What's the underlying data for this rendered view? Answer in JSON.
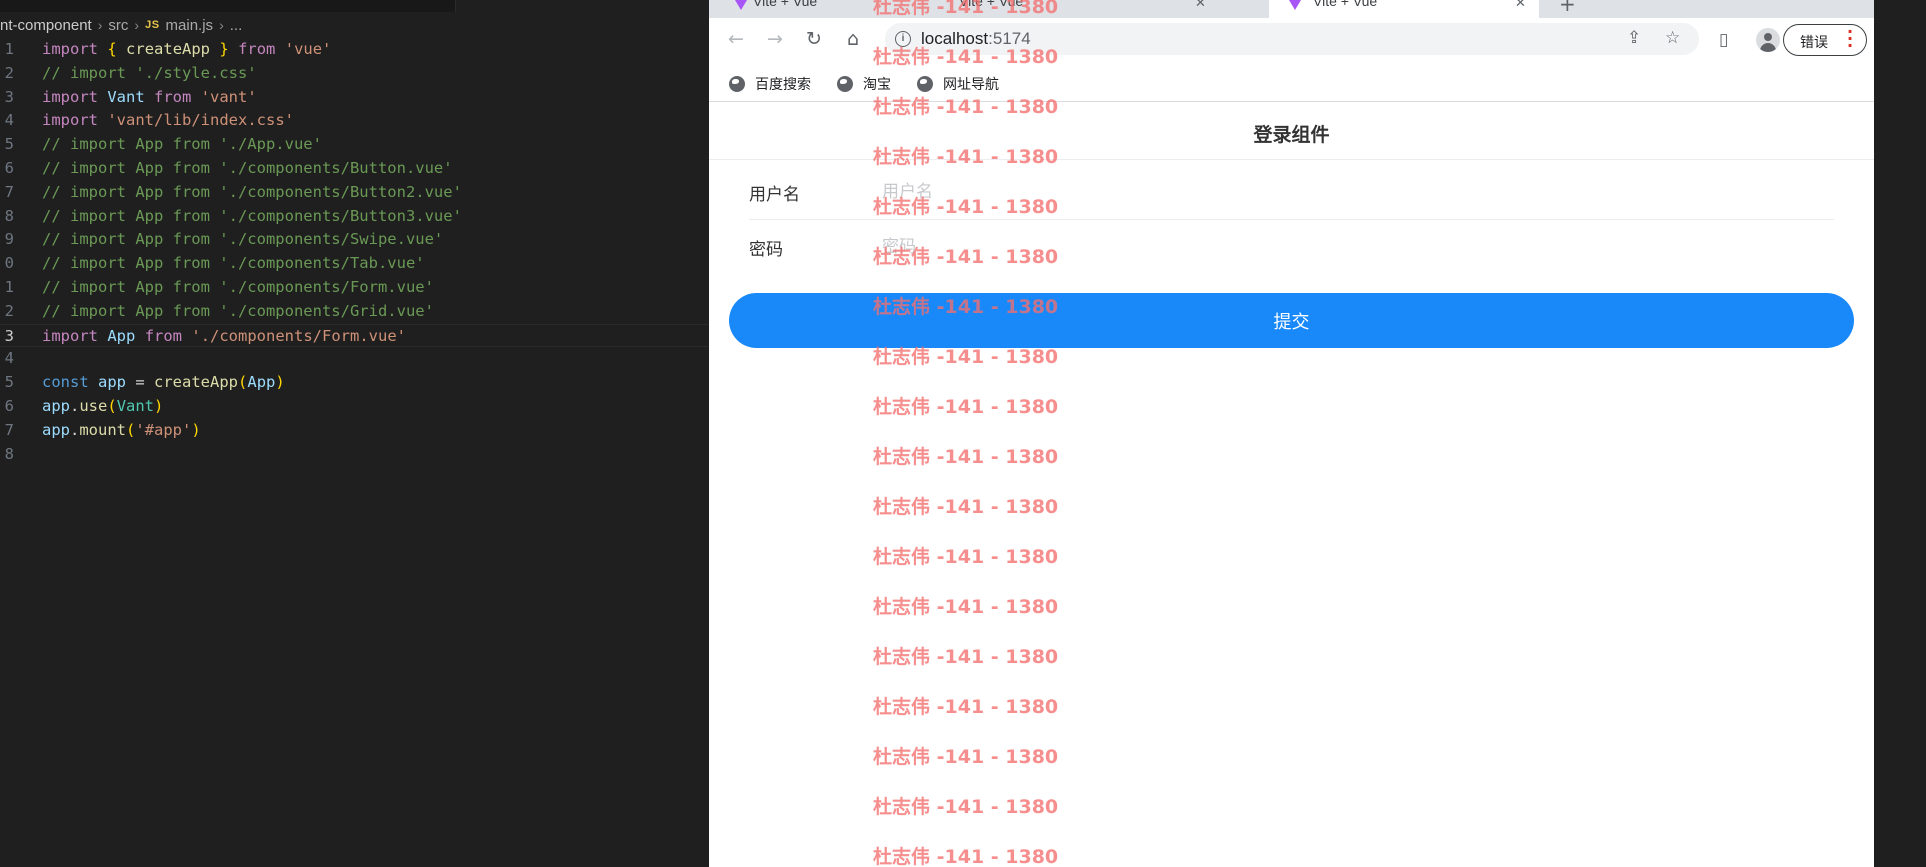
{
  "editor": {
    "breadcrumb": {
      "project": "nt-component",
      "folder": "src",
      "file_icon": "JS",
      "file": "main.js",
      "more": "..."
    },
    "active_line": 13,
    "lines": [
      {
        "n": "1",
        "tokens": [
          [
            "kw",
            "import"
          ],
          [
            "pl",
            " "
          ],
          [
            "br",
            "{"
          ],
          [
            "pl",
            " "
          ],
          [
            "fn",
            "createApp"
          ],
          [
            "pl",
            " "
          ],
          [
            "br",
            "}"
          ],
          [
            "pl",
            " "
          ],
          [
            "kw",
            "from"
          ],
          [
            "pl",
            " "
          ],
          [
            "str",
            "'vue'"
          ]
        ]
      },
      {
        "n": "2",
        "tokens": [
          [
            "cm",
            "// import './style.css'"
          ]
        ]
      },
      {
        "n": "3",
        "tokens": [
          [
            "kw",
            "import"
          ],
          [
            "pl",
            " "
          ],
          [
            "id",
            "Vant"
          ],
          [
            "pl",
            " "
          ],
          [
            "kw",
            "from"
          ],
          [
            "pl",
            " "
          ],
          [
            "str",
            "'vant'"
          ]
        ]
      },
      {
        "n": "4",
        "tokens": [
          [
            "kw",
            "import"
          ],
          [
            "pl",
            " "
          ],
          [
            "str",
            "'vant/lib/index.css'"
          ]
        ]
      },
      {
        "n": "5",
        "tokens": [
          [
            "cm",
            "// import App from './App.vue'"
          ]
        ]
      },
      {
        "n": "6",
        "tokens": [
          [
            "cm",
            "// import App from './components/Button.vue'"
          ]
        ]
      },
      {
        "n": "7",
        "tokens": [
          [
            "cm",
            "// import App from './components/Button2.vue'"
          ]
        ]
      },
      {
        "n": "8",
        "tokens": [
          [
            "cm",
            "// import App from './components/Button3.vue'"
          ]
        ]
      },
      {
        "n": "9",
        "tokens": [
          [
            "cm",
            "// import App from './components/Swipe.vue'"
          ]
        ]
      },
      {
        "n": "0",
        "tokens": [
          [
            "cm",
            "// import App from './components/Tab.vue'"
          ]
        ]
      },
      {
        "n": "1",
        "tokens": [
          [
            "cm",
            "// import App from './components/Form.vue'"
          ]
        ]
      },
      {
        "n": "2",
        "tokens": [
          [
            "cm",
            "// import App from './components/Grid.vue'"
          ]
        ]
      },
      {
        "n": "3",
        "tokens": [
          [
            "kw",
            "import"
          ],
          [
            "pl",
            " "
          ],
          [
            "id",
            "App"
          ],
          [
            "pl",
            " "
          ],
          [
            "kw",
            "from"
          ],
          [
            "pl",
            " "
          ],
          [
            "str",
            "'./components/Form.vue'"
          ]
        ]
      },
      {
        "n": "4",
        "tokens": []
      },
      {
        "n": "5",
        "tokens": [
          [
            "const",
            "const"
          ],
          [
            "pl",
            " "
          ],
          [
            "id",
            "app"
          ],
          [
            "pl",
            " = "
          ],
          [
            "fn",
            "createApp"
          ],
          [
            "br",
            "("
          ],
          [
            "id",
            "App"
          ],
          [
            "br",
            ")"
          ]
        ]
      },
      {
        "n": "6",
        "tokens": [
          [
            "id",
            "app"
          ],
          [
            "pl",
            "."
          ],
          [
            "fn",
            "use"
          ],
          [
            "br",
            "("
          ],
          [
            "cls",
            "Vant"
          ],
          [
            "br",
            ")"
          ]
        ]
      },
      {
        "n": "7",
        "tokens": [
          [
            "id",
            "app"
          ],
          [
            "pl",
            "."
          ],
          [
            "fn",
            "mount"
          ],
          [
            "br",
            "("
          ],
          [
            "str",
            "'#app'"
          ],
          [
            "br",
            ")"
          ]
        ]
      },
      {
        "n": "8",
        "tokens": []
      }
    ]
  },
  "browser": {
    "tabs": [
      {
        "title": "Vite + Vue",
        "active": false
      },
      {
        "title": "Vite + Vue",
        "active": false
      },
      {
        "title": "Vite + Vue",
        "active": true
      }
    ],
    "new_tab": "+",
    "address": {
      "host": "localhost",
      "port": ":5174"
    },
    "error_button": "错误",
    "bookmarks": [
      "百度搜索",
      "淘宝",
      "网址导航"
    ],
    "icons": {
      "back": "back-arrow-icon",
      "forward": "forward-arrow-icon",
      "reload": "reload-icon",
      "home": "home-icon",
      "info": "info-icon",
      "share": "share-icon",
      "star": "star-icon",
      "sidepanel": "side-panel-icon",
      "profile": "avatar-icon",
      "menu": "kebab-menu-icon",
      "bookmark": "globe-icon"
    }
  },
  "app": {
    "title": "登录组件",
    "fields": [
      {
        "label": "用户名",
        "placeholder": "用户名",
        "value": ""
      },
      {
        "label": "密码",
        "placeholder": "密码",
        "value": ""
      }
    ],
    "submit_label": "提交"
  },
  "watermark": {
    "text": "杜志伟 -141 - 1380",
    "color": "#f46e6e"
  },
  "colors": {
    "primary": "#1989fa",
    "editor_bg": "#1f1f1f",
    "error": "#d93025"
  }
}
